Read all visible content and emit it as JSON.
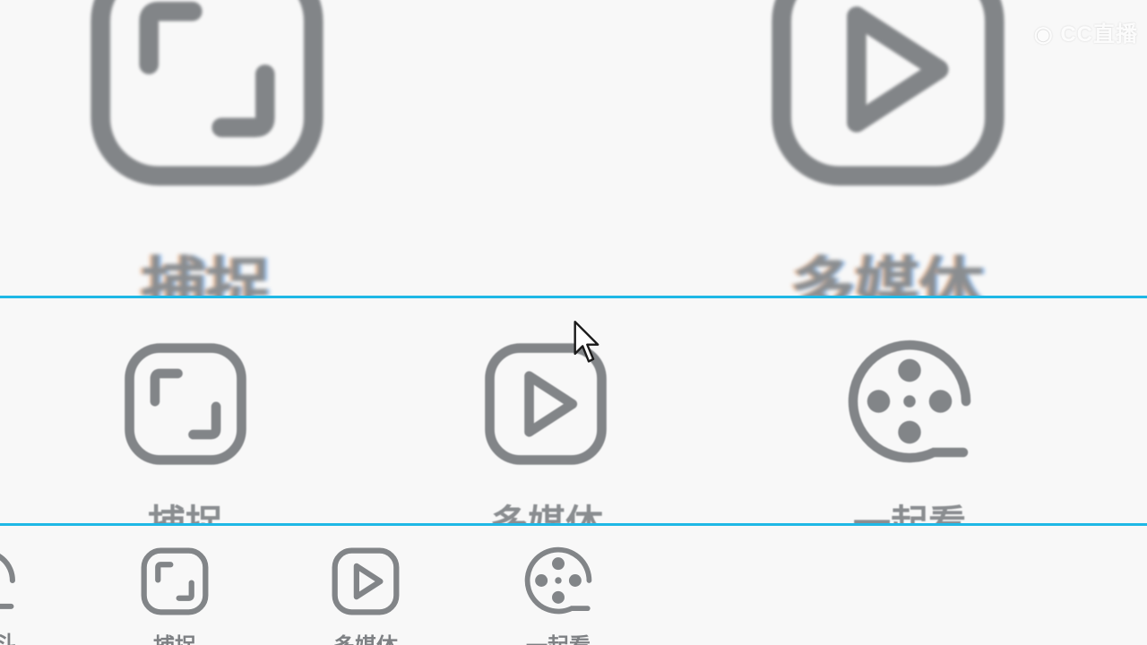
{
  "watermark": {
    "text": "CC直播",
    "logo_icon": "eye-logo-icon"
  },
  "colors": {
    "icon_gray": "#828588",
    "divider": "#1fb8e6",
    "background": "#f8f8f8"
  },
  "menu": {
    "capture_label": "捕捉",
    "multimedia_label": "多媒体",
    "watch_together_label": "一起看",
    "partial_left_label": "斗"
  },
  "icons": {
    "capture": "capture-frame-icon",
    "multimedia": "play-icon",
    "watch_together": "film-reel-icon"
  },
  "cursor": "mouse-pointer-icon"
}
